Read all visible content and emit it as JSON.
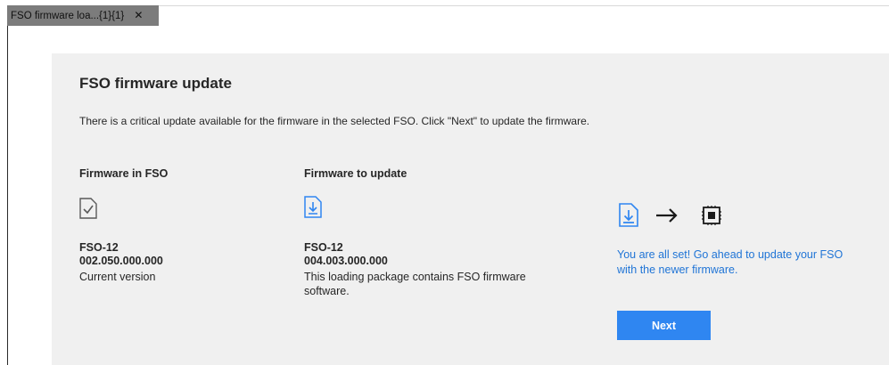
{
  "tab": {
    "label": "FSO firmware loa...{1}{1}",
    "close": "✕"
  },
  "panel": {
    "title": "FSO firmware update",
    "description": "There is a critical update available for the firmware in the selected FSO. Click \"Next\" to update the firmware.",
    "current": {
      "heading": "Firmware in FSO",
      "name": "FSO-12",
      "version": "002.050.000.000",
      "note": "Current version"
    },
    "update": {
      "heading": "Firmware to update",
      "name": "FSO-12",
      "version": "004.003.000.000",
      "note_line1": "This loading package contains FSO firmware",
      "note_line2": "software."
    },
    "status": {
      "line1": "You are all set! Go ahead to update your FSO",
      "line2": "with the newer firmware."
    },
    "next_label": "Next"
  },
  "colors": {
    "accent": "#2f86f1",
    "link": "#1f74d6",
    "panel_bg": "#f0f0f0",
    "tab_bg": "#7c7c7c"
  },
  "icons": [
    "document-check-icon",
    "document-download-icon",
    "arrow-right-icon",
    "chip-icon",
    "close-icon"
  ]
}
